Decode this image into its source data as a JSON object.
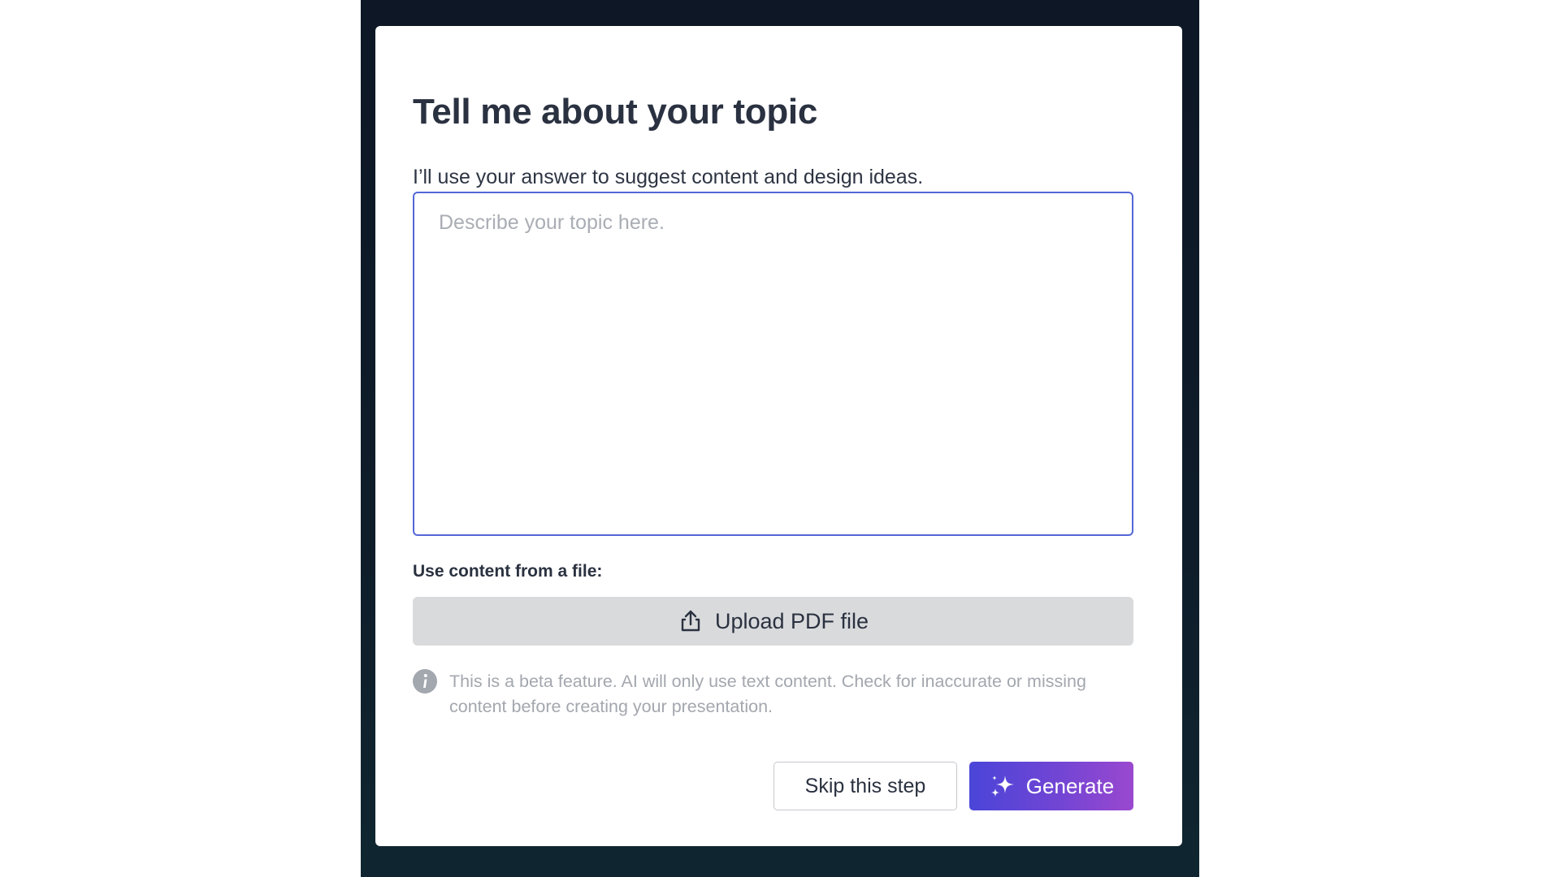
{
  "dialog": {
    "title": "Tell me about your topic",
    "subtitle": "I’ll use your answer to suggest content and design ideas.",
    "topic_input": {
      "value": "",
      "placeholder": "Describe your topic here."
    },
    "file_section_label": "Use content from a file:",
    "upload_button": {
      "label": "Upload PDF file",
      "icon": "upload-icon"
    },
    "notice": {
      "icon": "info-icon",
      "text": "This is a beta feature. AI will only use text content. Check for inaccurate or missing content before creating your presentation."
    },
    "skip_button": {
      "label": "Skip this step"
    },
    "generate_button": {
      "label": "Generate",
      "icon": "sparkle-icon"
    }
  },
  "colors": {
    "backdrop": "#0d1725",
    "dialog_background": "#ffffff",
    "input_focus_border": "#5367d6",
    "upload_button_bg": "#d9dadc",
    "generate_gradient_start": "#4a45d8",
    "generate_gradient_end": "#9a48cf",
    "muted_text": "#a3a7ae",
    "primary_text": "#2a3140"
  }
}
